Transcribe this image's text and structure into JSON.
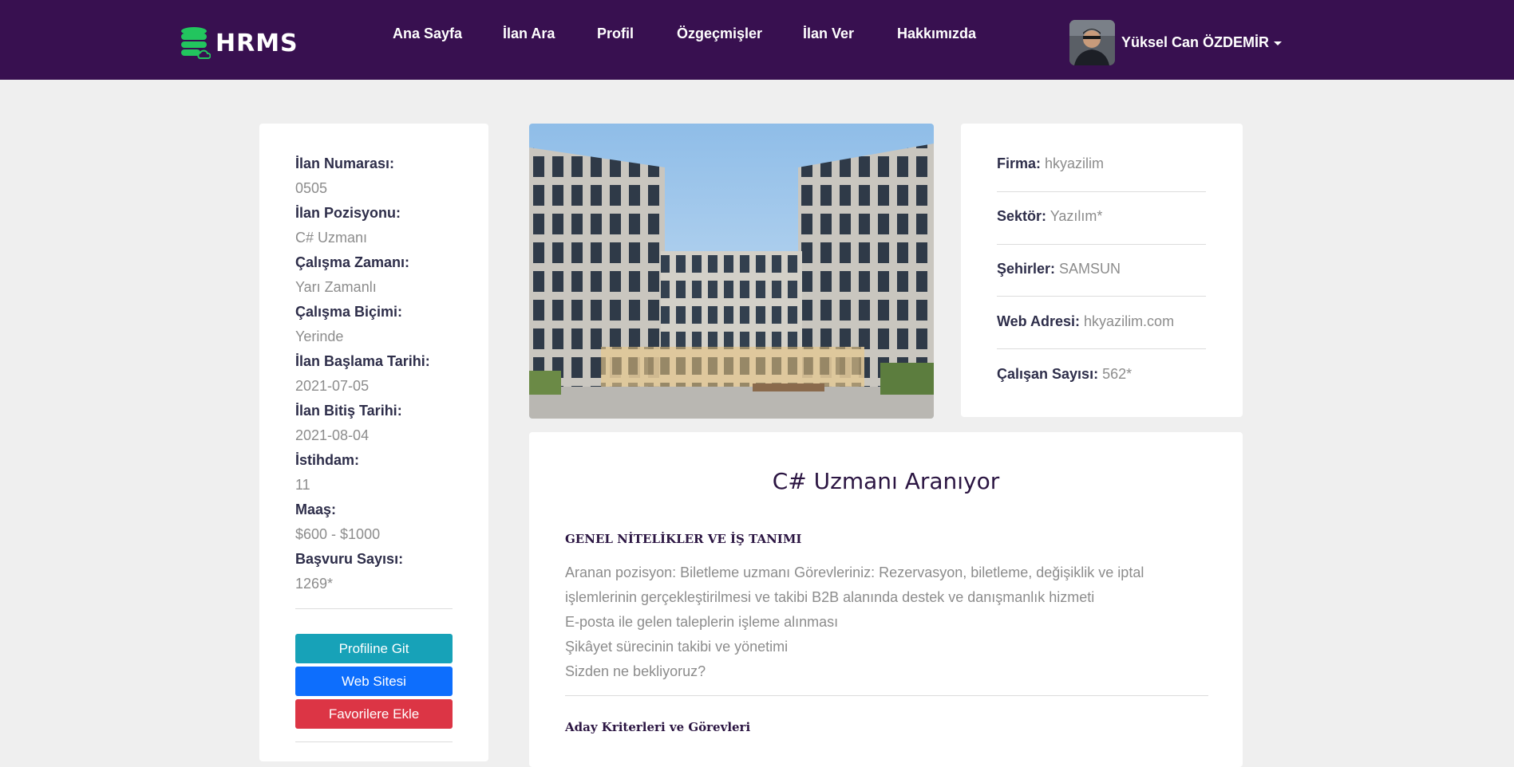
{
  "header": {
    "logo_text": "HRMS",
    "nav": [
      {
        "label": "Ana Sayfa"
      },
      {
        "label": "İlan Ara"
      },
      {
        "label": "Profil"
      },
      {
        "label": "Özgeçmişler"
      },
      {
        "label": "İlan Ver"
      },
      {
        "label": "Hakkımızda"
      }
    ],
    "user": {
      "name": "Yüksel Can ÖZDEMİR",
      "avatar_icon": "user-avatar"
    }
  },
  "job_details": {
    "items": [
      {
        "label": "İlan Numarası:",
        "value": "0505"
      },
      {
        "label": "İlan Pozisyonu:",
        "value": "C# Uzmanı"
      },
      {
        "label": "Çalışma Zamanı:",
        "value": "Yarı Zamanlı"
      },
      {
        "label": "Çalışma Biçimi:",
        "value": "Yerinde"
      },
      {
        "label": "İlan Başlama Tarihi:",
        "value": "2021-07-05"
      },
      {
        "label": "İlan Bitiş Tarihi:",
        "value": "2021-08-04"
      },
      {
        "label": "İstihdam:",
        "value": "11"
      },
      {
        "label": "Maaş:",
        "value": "$600 - $1000"
      },
      {
        "label": "Başvuru Sayısı:",
        "value": "1269*"
      }
    ],
    "buttons": {
      "profile": "Profiline Git",
      "website": "Web Sitesi",
      "favorite": "Favorilere Ekle"
    }
  },
  "company": {
    "rows": [
      {
        "label": "Firma:",
        "value": "hkyazilim"
      },
      {
        "label": "Sektör:",
        "value": "Yazılım*"
      },
      {
        "label": "Şehirler:",
        "value": "SAMSUN"
      },
      {
        "label": "Web Adresi:",
        "value": "hkyazilim.com"
      },
      {
        "label": "Çalışan Sayısı:",
        "value": "562*"
      }
    ]
  },
  "description": {
    "title": "C# Uzmanı Aranıyor",
    "section1_heading": "GENEL NİTELİKLER VE İŞ TANIMI",
    "lines": [
      "Aranan pozisyon: Biletleme uzmanı Görevleriniz: Rezervasyon, biletleme, değişiklik ve iptal",
      "işlemlerinin gerçekleştirilmesi ve takibi B2B alanında destek ve danışmanlık hizmeti",
      "E-posta ile gelen taleplerin işleme alınması",
      "Şikâyet sürecinin takibi ve yönetimi",
      "Sizden ne bekliyoruz?"
    ],
    "section2_heading": "Aday Kriterleri ve Görevleri"
  },
  "colors": {
    "navbar": "#381050",
    "btn_profile": "#17a2b8",
    "btn_website": "#0d6efd",
    "btn_favorite": "#dc3545",
    "logo_green": "#22c55e"
  }
}
